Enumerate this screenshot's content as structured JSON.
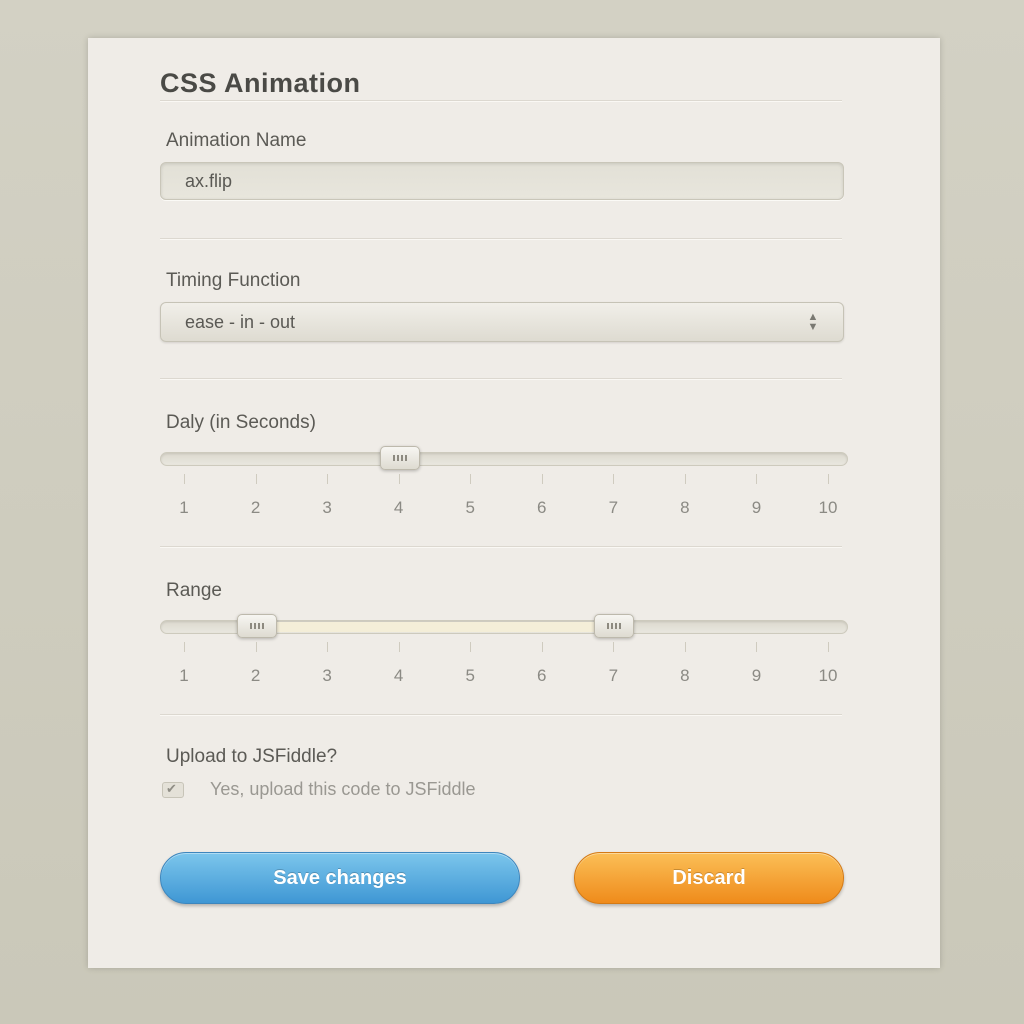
{
  "form": {
    "title": "CSS Animation",
    "animation_name": {
      "label": "Animation Name",
      "value": "ax.flip"
    },
    "timing_function": {
      "label": "Timing Function",
      "selected": "ease - in - out"
    },
    "delay": {
      "label": "Daly (in Seconds)",
      "value": 4,
      "min": 1,
      "max": 10,
      "ticks": [
        "1",
        "2",
        "3",
        "4",
        "5",
        "6",
        "7",
        "8",
        "9",
        "10"
      ]
    },
    "range": {
      "label": "Range",
      "low": 2,
      "high": 7,
      "min": 1,
      "max": 10,
      "ticks": [
        "1",
        "2",
        "3",
        "4",
        "5",
        "6",
        "7",
        "8",
        "9",
        "10"
      ]
    },
    "upload": {
      "label": "Upload to JSFiddle?",
      "checkbox_label": "Yes, upload this code to JSFiddle",
      "checked": true
    },
    "save_label": "Save changes",
    "discard_label": "Discard"
  },
  "colors": {
    "save_button": "#4aa3dc",
    "discard_button": "#f39a2a",
    "panel_bg": "#efece7",
    "page_bg": "#cdcbbd"
  },
  "icons": {
    "select_arrow": "select-arrows-icon",
    "checkmark": "checkmark-icon",
    "slider_handle": "slider-grip-icon"
  }
}
